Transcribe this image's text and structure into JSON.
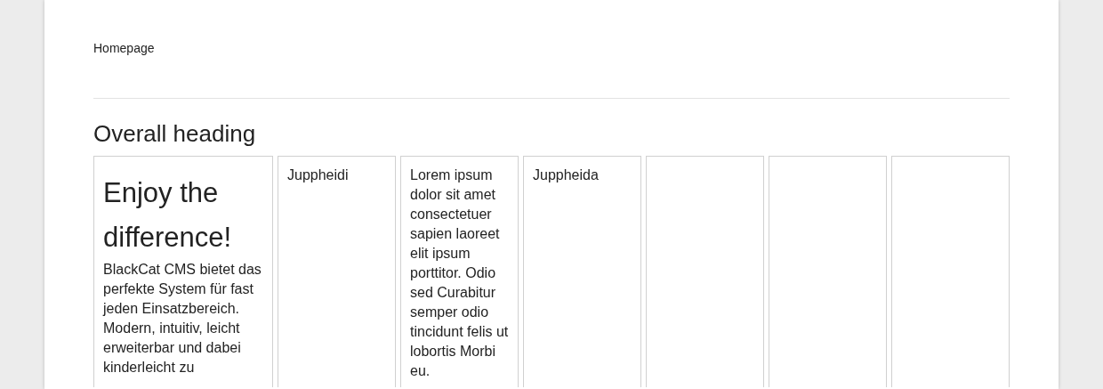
{
  "breadcrumb": "Homepage",
  "heading": "Overall heading",
  "columns": [
    {
      "kind": "intro",
      "title": "Enjoy the difference!",
      "text": "BlackCat CMS bietet das perfekte System für fast jeden Einsatzbereich. Modern, intuitiv, leicht erweiterbar und dabei kinderleicht zu"
    },
    {
      "kind": "text",
      "text": "Juppheidi"
    },
    {
      "kind": "text",
      "text": "Lorem ipsum dolor sit amet consectetuer sapien laoreet elit ipsum porttitor. Odio sed Curabitur semper odio tincidunt felis ut lobortis Morbi eu."
    },
    {
      "kind": "text",
      "text": "Juppheida"
    },
    {
      "kind": "empty"
    },
    {
      "kind": "empty"
    },
    {
      "kind": "empty"
    }
  ]
}
